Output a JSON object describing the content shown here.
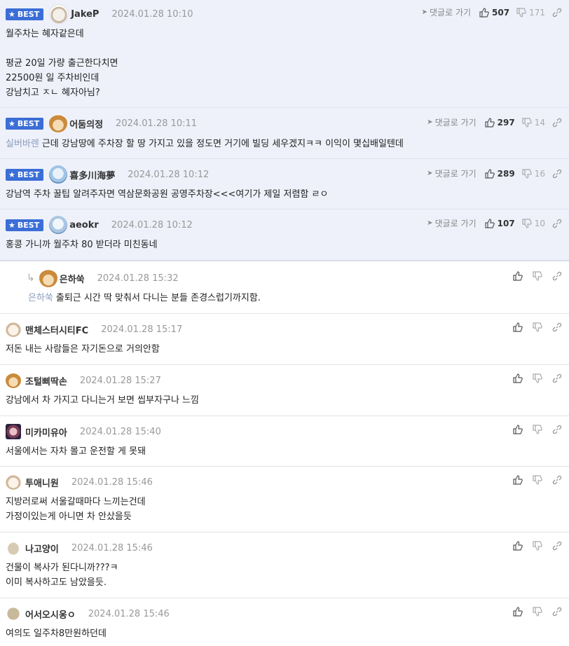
{
  "labels": {
    "best": "BEST",
    "reply": "댓글로 가기"
  },
  "comments": [
    {
      "best": true,
      "nick": "JakeP",
      "date": "2024.01.28 10:10",
      "lines": [
        "월주차는 혜자같은데",
        "",
        "평균 20일 가량 출근한다치면",
        "22500원 일 주차비인데",
        "강남치고 ㅈㄴ 혜자아님?"
      ],
      "up": "507",
      "down": "171",
      "avatar": "dog-white"
    },
    {
      "best": true,
      "nick": "어둠의정",
      "date": "2024.01.28 10:11",
      "mention": "실버바렌",
      "text": "근데 강남땅에 주차장 할 땅 가지고 있을 정도면 거기에 빌딩 세우겠지ㅋㅋ 이익이 몇십배일텐데",
      "up": "297",
      "down": "14",
      "avatar": "chihuahua"
    },
    {
      "best": true,
      "nick": "喜多川海夢",
      "date": "2024.01.28 10:12",
      "text": "강남역 주차 꿀팁 알려주자면 역삼문화공원 공영주차장<<<여기가 제일 저렴함 ㄹㅇ",
      "up": "289",
      "down": "16",
      "avatar": "anime"
    },
    {
      "best": true,
      "nick": "aeokr",
      "date": "2024.01.28 10:12",
      "text": "홍콩 가니까 월주차 80 받더라 미친동네",
      "up": "107",
      "down": "10",
      "avatar": "anime2"
    },
    {
      "reply": true,
      "nick": "은하쑥",
      "date": "2024.01.28 15:32",
      "mention": "은하쑥",
      "text": "출퇴근 시간 딱 맞춰서 다니는 분들 존경스럽기까지함.",
      "avatar": "chihuahua"
    },
    {
      "nick": "맨체스터시티FC",
      "date": "2024.01.28 15:17",
      "text": "저돈 내는 사람들은 자기돈으로 거의안함",
      "avatar": "maltese"
    },
    {
      "nick": "조털삐딱손",
      "date": "2024.01.28 15:27",
      "text": "강남에서 차 가지고 다니는거 보면 씹부자구나 느낌",
      "avatar": "chihuahua"
    },
    {
      "nick": "미카미유아",
      "date": "2024.01.28 15:40",
      "text": "서울에서는 자차 몰고 운전할 게 못돼",
      "avatar": "anime3"
    },
    {
      "nick": "투애니원",
      "date": "2024.01.28 15:46",
      "lines": [
        "지방러로써 서울갈때마다 느끼는건데",
        "가정이있는게 아니면 차 안샀을듯"
      ],
      "avatar": "maltese"
    },
    {
      "nick": "나고양이",
      "date": "2024.01.28 15:46",
      "lines": [
        "건물이 복사가 된다니까???ㅋ",
        "이미 복사하고도 남았을듯."
      ],
      "avatar": "blob"
    },
    {
      "nick": "어서오시옹ㅇ",
      "date": "2024.01.28 15:46",
      "text": "여의도 일주차8만원하던데",
      "avatar": "blob2"
    }
  ]
}
